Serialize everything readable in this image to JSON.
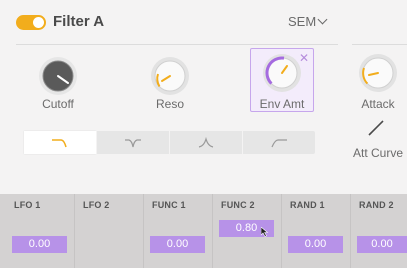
{
  "header": {
    "title": "Filter A",
    "mode": "SEM",
    "toggle_on": true,
    "accent": "#f2ad1c"
  },
  "knobs": [
    {
      "label": "Cutoff",
      "value_fraction": 0.82
    },
    {
      "label": "Reso",
      "value_fraction": 0.25
    },
    {
      "label": "Env Amt",
      "value_fraction": 0.55,
      "selected": true
    },
    {
      "label": "Attack",
      "value_fraction": 0.2
    }
  ],
  "attack_curve": {
    "label": "Att Curve"
  },
  "filter_types": [
    {
      "name": "low-pass",
      "selected": true
    },
    {
      "name": "notch",
      "selected": false
    },
    {
      "name": "band-pass",
      "selected": false
    },
    {
      "name": "high-pass",
      "selected": false
    }
  ],
  "mod_sources": [
    {
      "label": "LFO 1",
      "value": "0.00"
    },
    {
      "label": "LFO 2",
      "value": ""
    },
    {
      "label": "FUNC 1",
      "value": "0.00"
    },
    {
      "label": "FUNC 2",
      "value": "0.80"
    },
    {
      "label": "RAND 1",
      "value": "0.00"
    },
    {
      "label": "RAND 2",
      "value": "0.00"
    }
  ],
  "colors": {
    "mod_value": "#b792e8",
    "selection": "#c6a6ec"
  }
}
